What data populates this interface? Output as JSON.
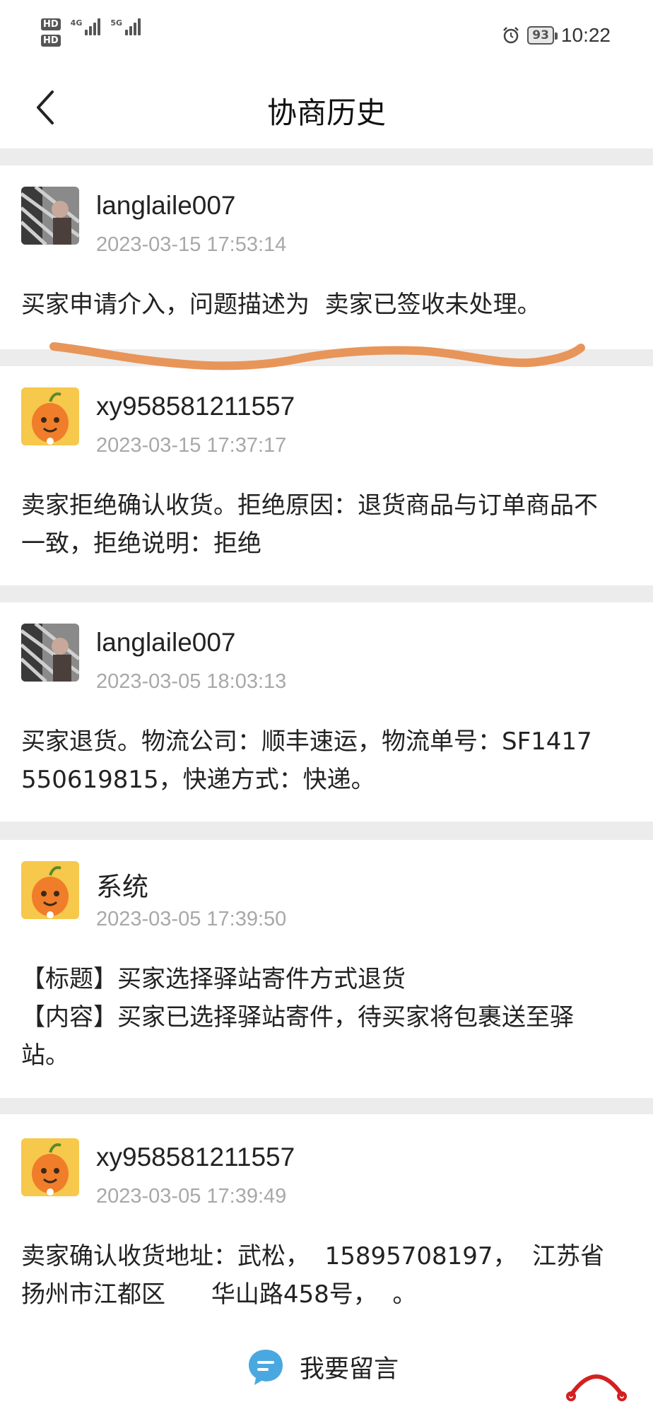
{
  "status": {
    "hd1": "HD",
    "hd2": "HD",
    "net1": "4G",
    "net2": "5G",
    "battery": "93",
    "time": "10:22"
  },
  "header": {
    "title": "协商历史",
    "back_icon": "chevron-left-icon"
  },
  "entries": [
    {
      "avatar": "photo-avatar",
      "name": "langlaile007",
      "time": "2023-03-15 17:53:14",
      "body": "买家申请介入，问题描述为  卖家已签收未处理。"
    },
    {
      "avatar": "mascot-avatar",
      "name": "xy958581211557",
      "time": "2023-03-15 17:37:17",
      "body": "卖家拒绝确认收货。拒绝原因：退货商品与订单商品不\n一致，拒绝说明：拒绝"
    },
    {
      "avatar": "photo-avatar",
      "name": "langlaile007",
      "time": "2023-03-05 18:03:13",
      "body": "买家退货。物流公司：顺丰速运，物流单号：SF1417\n550619815，快递方式：快递。"
    },
    {
      "avatar": "mascot-avatar",
      "name": "系统",
      "time": "2023-03-05 17:39:50",
      "body": "【标题】买家选择驿站寄件方式退货\n【内容】买家已选择驿站寄件，待买家将包裹送至驿\n站。"
    },
    {
      "avatar": "mascot-avatar",
      "name": "xy958581211557",
      "time": "2023-03-05 17:39:49",
      "body": "卖家确认收货地址：武松，  15895708197，  江苏省\n扬州市江都区      华山路458号，  。"
    }
  ],
  "footer": {
    "message_label": "我要留言",
    "message_icon": "chat-bubble-icon"
  },
  "colors": {
    "highlight_stroke": "#e8955a",
    "message_icon": "#4aa8e0",
    "corner_logo": "#d42020"
  }
}
